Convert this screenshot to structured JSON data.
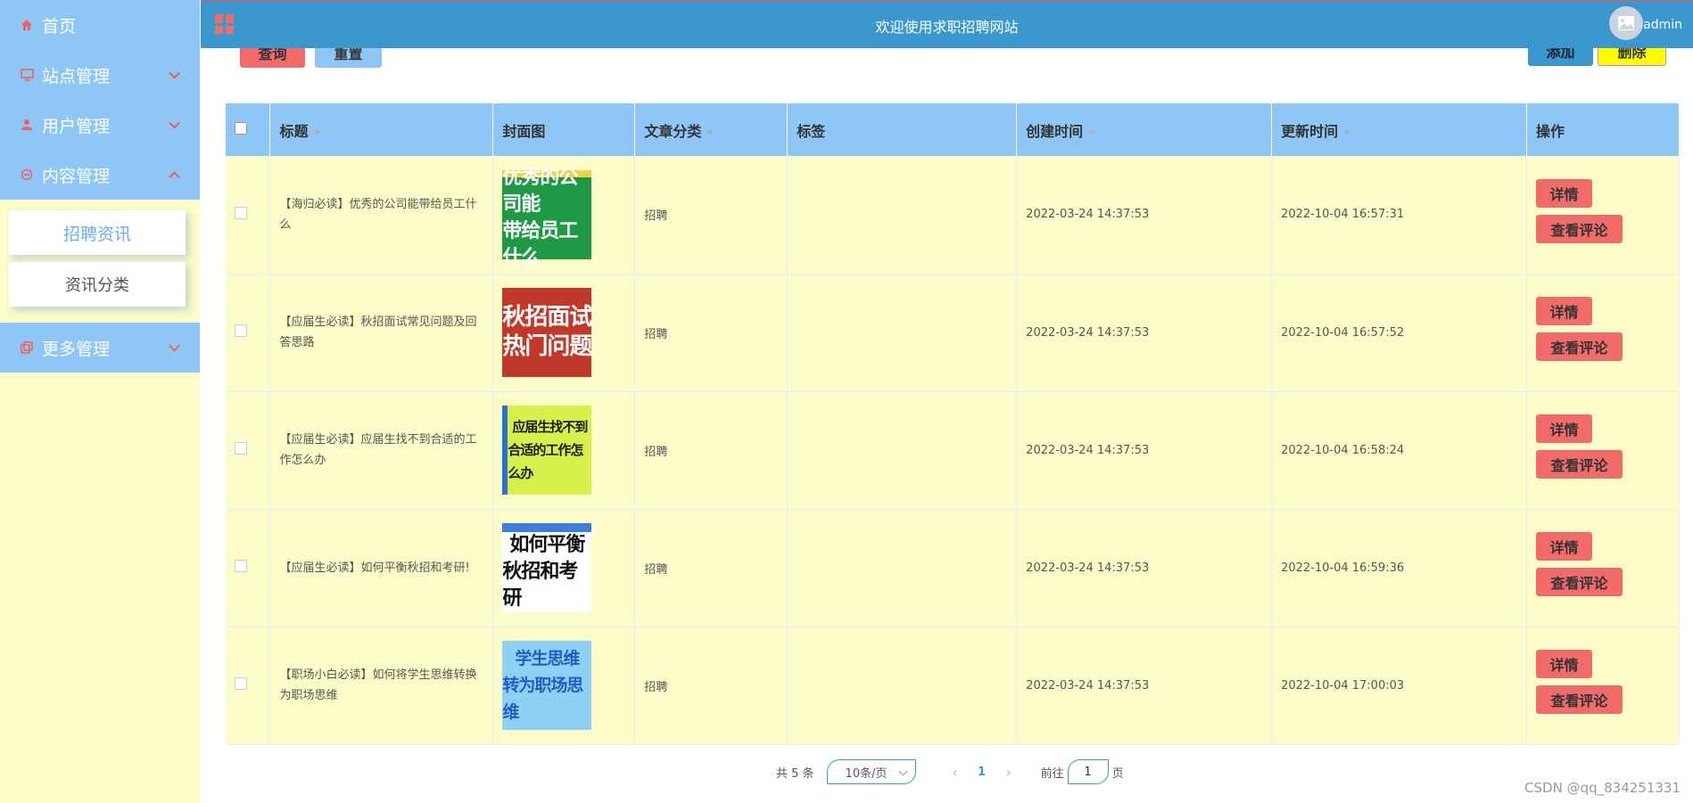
{
  "sidebar": {
    "items": [
      {
        "label": "首页",
        "icon": "home-icon"
      },
      {
        "label": "站点管理",
        "icon": "monitor-icon"
      },
      {
        "label": "用户管理",
        "icon": "user-icon"
      },
      {
        "label": "内容管理",
        "icon": "chat-icon"
      }
    ],
    "sub_items": [
      {
        "label": "招聘资讯",
        "active": true
      },
      {
        "label": "资讯分类",
        "active": false
      }
    ],
    "more": {
      "label": "更多管理",
      "icon": "copy-icon"
    }
  },
  "header": {
    "title": "欢迎使用求职招聘网站",
    "username": "admin"
  },
  "toolbar": {
    "query_label": "查询",
    "reset_label": "重置",
    "add_label": "添加",
    "delete_label": "删除"
  },
  "table": {
    "columns": [
      "标题",
      "封面图",
      "文章分类",
      "标签",
      "创建时间",
      "更新时间",
      "操作"
    ],
    "detail_label": "详情",
    "comment_label": "查看评论",
    "rows": [
      {
        "title": "【海归必读】优秀的公司能带给员工什么",
        "cover_text": [
          "优秀的公司能",
          "带给员工什么"
        ],
        "category": "招聘",
        "tags": "",
        "created": "2022-03-24 14:37:53",
        "updated": "2022-10-04 16:57:31"
      },
      {
        "title": "【应届生必读】秋招面试常见问题及回答思路",
        "cover_text": [
          "秋招面试",
          "热门问题"
        ],
        "category": "招聘",
        "tags": "",
        "created": "2022-03-24 14:37:53",
        "updated": "2022-10-04 16:57:52"
      },
      {
        "title": "【应届生必读】应届生找不到合适的工作怎么办",
        "cover_text": [
          "应届生找不到",
          "合适的工作怎么办"
        ],
        "category": "招聘",
        "tags": "",
        "created": "2022-03-24 14:37:53",
        "updated": "2022-10-04 16:58:24"
      },
      {
        "title": "【应届生必读】如何平衡秋招和考研!",
        "cover_text": [
          "如何平衡",
          "秋招和考研"
        ],
        "category": "招聘",
        "tags": "",
        "created": "2022-03-24 14:37:53",
        "updated": "2022-10-04 16:59:36"
      },
      {
        "title": "【职场小白必读】如何将学生思维转换为职场思维",
        "cover_text": [
          "学生思维",
          "转为职场思维"
        ],
        "category": "招聘",
        "tags": "",
        "created": "2022-03-24 14:37:53",
        "updated": "2022-10-04 17:00:03"
      }
    ]
  },
  "pagination": {
    "total_text": "共 5 条",
    "page_size": "10条/页",
    "current_page": "1",
    "goto_prefix": "前往",
    "goto_value": "1",
    "goto_suffix": "页"
  },
  "watermark": "CSDN @qq_834251331",
  "colors": {
    "sidebar_header": "#8ec7f5",
    "sidebar_bg": "#fcfcc8",
    "topbar": "#3a98cf",
    "accent_red": "#f26b6b",
    "delete_yellow": "#ffff00"
  }
}
